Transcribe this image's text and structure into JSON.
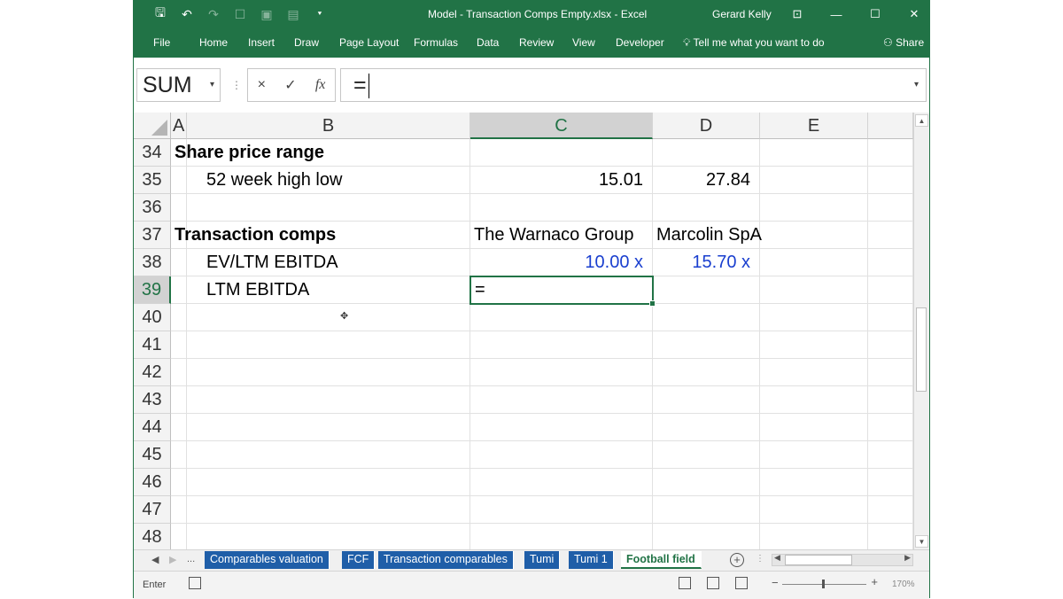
{
  "titlebar": {
    "title": "Model - Transaction Comps Empty.xlsx  -  Excel",
    "user": "Gerard Kelly",
    "qat": [
      {
        "name": "save-icon",
        "glyph": "🖫"
      },
      {
        "name": "undo-icon",
        "glyph": "↶"
      },
      {
        "name": "redo-icon",
        "glyph": "↷"
      },
      {
        "name": "touch-mode-icon",
        "glyph": "☐"
      },
      {
        "name": "camera-icon",
        "glyph": "▣"
      },
      {
        "name": "form-icon",
        "glyph": "▤"
      },
      {
        "name": "customize-qat-icon",
        "glyph": "⯆"
      }
    ],
    "controls": [
      {
        "name": "ribbon-display-options-icon",
        "glyph": "⊡"
      },
      {
        "name": "minimize-icon",
        "glyph": "—"
      },
      {
        "name": "maximize-icon",
        "glyph": "☐"
      },
      {
        "name": "close-icon",
        "glyph": "✕"
      }
    ]
  },
  "ribbon": {
    "tabs": [
      "File",
      "Home",
      "Insert",
      "Draw",
      "Page Layout",
      "Formulas",
      "Data",
      "Review",
      "View",
      "Developer"
    ],
    "tell_me": "Tell me what you want to do",
    "share": "Share"
  },
  "formula_bar": {
    "name_box": "SUM",
    "cancel": "×",
    "enter": "✓",
    "fx": "fx",
    "formula": "="
  },
  "columns": [
    "A",
    "B",
    "C",
    "D",
    "E"
  ],
  "selected_column": "C",
  "rows": [
    "34",
    "35",
    "36",
    "37",
    "38",
    "39",
    "40",
    "41",
    "42",
    "43",
    "44",
    "45",
    "46",
    "47",
    "48"
  ],
  "selected_row": "39",
  "cells": {
    "b34": "Share price range",
    "b35": "52 week high low",
    "c35": "15.01",
    "d35": "27.84",
    "b37": "Transaction comps",
    "c37": "The Warnaco Group",
    "d37": "Marcolin SpA",
    "b38": "EV/LTM EBITDA",
    "c38": "10.00 x",
    "d38": "15.70 x",
    "b39": "LTM EBITDA",
    "c39": "="
  },
  "sheet_tabs": {
    "more": "...",
    "tabs": [
      "Comparables valuation",
      "FCF",
      "Transaction comparables",
      "Tumi",
      "Tumi 1",
      "Football field"
    ],
    "active": "Football field"
  },
  "status_bar": {
    "mode": "Enter",
    "zoom": "170%",
    "zoom_level_percent": 170
  },
  "colors": {
    "excel_green": "#217346",
    "tab_blue": "#1f5ea8",
    "input_blue": "#1a3fcf"
  }
}
